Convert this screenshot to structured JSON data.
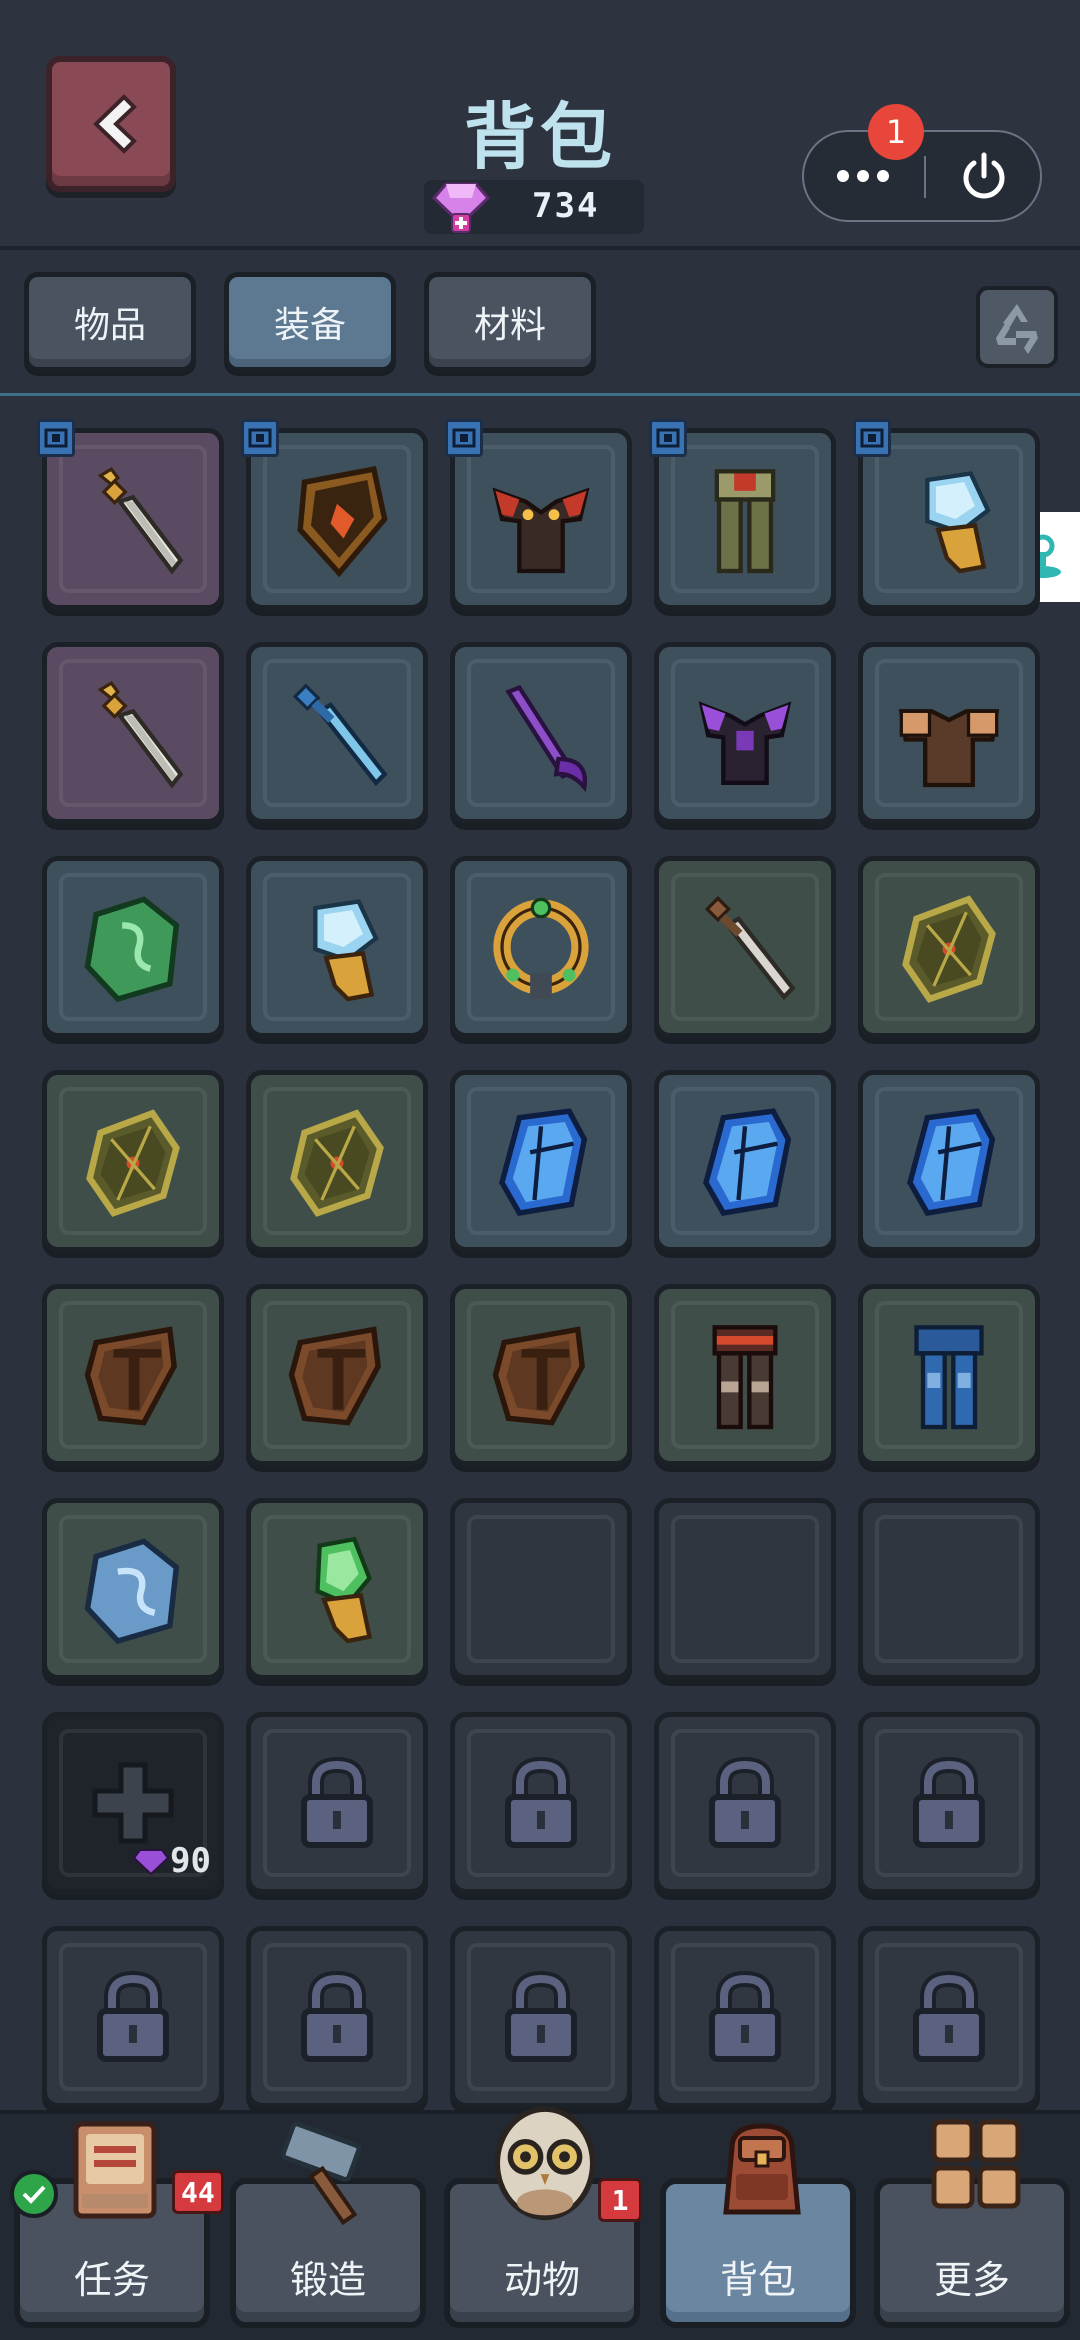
{
  "header": {
    "title": "背包",
    "currency_amount": "734",
    "notification_count": "1"
  },
  "tabs": [
    {
      "label": "物品",
      "active": false
    },
    {
      "label": "装备",
      "active": true
    },
    {
      "label": "材料",
      "active": false
    }
  ],
  "grid": {
    "add_slot_cost": "90",
    "rows": [
      [
        {
          "item": "golden-sword",
          "rarity": "purple",
          "equipped": true
        },
        {
          "item": "flame-shield",
          "rarity": "blue",
          "equipped": true
        },
        {
          "item": "horned-armor",
          "rarity": "blue",
          "equipped": true
        },
        {
          "item": "olive-leggings",
          "rarity": "blue",
          "equipped": true
        },
        {
          "item": "ice-crystal",
          "rarity": "blue",
          "equipped": true
        }
      ],
      [
        {
          "item": "golden-sword",
          "rarity": "purple",
          "equipped": false
        },
        {
          "item": "blue-sword",
          "rarity": "blue",
          "equipped": false
        },
        {
          "item": "purple-scythe",
          "rarity": "blue",
          "equipped": false
        },
        {
          "item": "purple-armor",
          "rarity": "blue",
          "equipped": false
        },
        {
          "item": "brown-armor",
          "rarity": "blue",
          "equipped": false
        }
      ],
      [
        {
          "item": "green-rune-stone",
          "rarity": "blue",
          "equipped": false
        },
        {
          "item": "ice-crystal",
          "rarity": "blue",
          "equipped": false
        },
        {
          "item": "gold-necklace",
          "rarity": "blue",
          "equipped": false
        },
        {
          "item": "iron-sword",
          "rarity": "green",
          "equipped": false
        },
        {
          "item": "olive-shield",
          "rarity": "green",
          "equipped": false
        }
      ],
      [
        {
          "item": "olive-shield",
          "rarity": "green",
          "equipped": false
        },
        {
          "item": "olive-shield",
          "rarity": "green",
          "equipped": false
        },
        {
          "item": "blue-bracer",
          "rarity": "blue",
          "equipped": false
        },
        {
          "item": "blue-bracer",
          "rarity": "blue",
          "equipped": false
        },
        {
          "item": "blue-bracer",
          "rarity": "blue",
          "equipped": false
        }
      ],
      [
        {
          "item": "wood-shield",
          "rarity": "green",
          "equipped": false
        },
        {
          "item": "wood-shield",
          "rarity": "green",
          "equipped": false
        },
        {
          "item": "wood-shield",
          "rarity": "green",
          "equipped": false
        },
        {
          "item": "red-leggings",
          "rarity": "green",
          "equipped": false
        },
        {
          "item": "blue-leggings",
          "rarity": "green",
          "equipped": false
        }
      ],
      [
        {
          "item": "blue-rune-stone",
          "rarity": "green",
          "equipped": false
        },
        {
          "item": "green-crystal",
          "rarity": "green",
          "equipped": false
        },
        {
          "item": "empty",
          "rarity": "empty",
          "equipped": false
        },
        {
          "item": "empty",
          "rarity": "empty",
          "equipped": false
        },
        {
          "item": "empty",
          "rarity": "empty",
          "equipped": false
        }
      ],
      [
        {
          "item": "add",
          "rarity": "add",
          "equipped": false
        },
        {
          "item": "locked",
          "rarity": "locked",
          "equipped": false
        },
        {
          "item": "locked",
          "rarity": "locked",
          "equipped": false
        },
        {
          "item": "locked",
          "rarity": "locked",
          "equipped": false
        },
        {
          "item": "locked",
          "rarity": "locked",
          "equipped": false
        }
      ],
      [
        {
          "item": "locked",
          "rarity": "locked",
          "equipped": false
        },
        {
          "item": "locked",
          "rarity": "locked",
          "equipped": false
        },
        {
          "item": "locked",
          "rarity": "locked",
          "equipped": false
        },
        {
          "item": "locked",
          "rarity": "locked",
          "equipped": false
        },
        {
          "item": "locked",
          "rarity": "locked",
          "equipped": false
        }
      ]
    ]
  },
  "nav": [
    {
      "label": "任务",
      "icon": "quest-book-icon",
      "badge": "44",
      "done": true
    },
    {
      "label": "锻造",
      "icon": "forge-hammer-icon",
      "badge": "",
      "done": false
    },
    {
      "label": "动物",
      "icon": "owl-pet-icon",
      "badge": "1",
      "done": false
    },
    {
      "label": "背包",
      "icon": "backpack-icon",
      "badge": "",
      "done": false,
      "active": true
    },
    {
      "label": "更多",
      "icon": "more-grid-icon",
      "badge": "",
      "done": false
    }
  ]
}
